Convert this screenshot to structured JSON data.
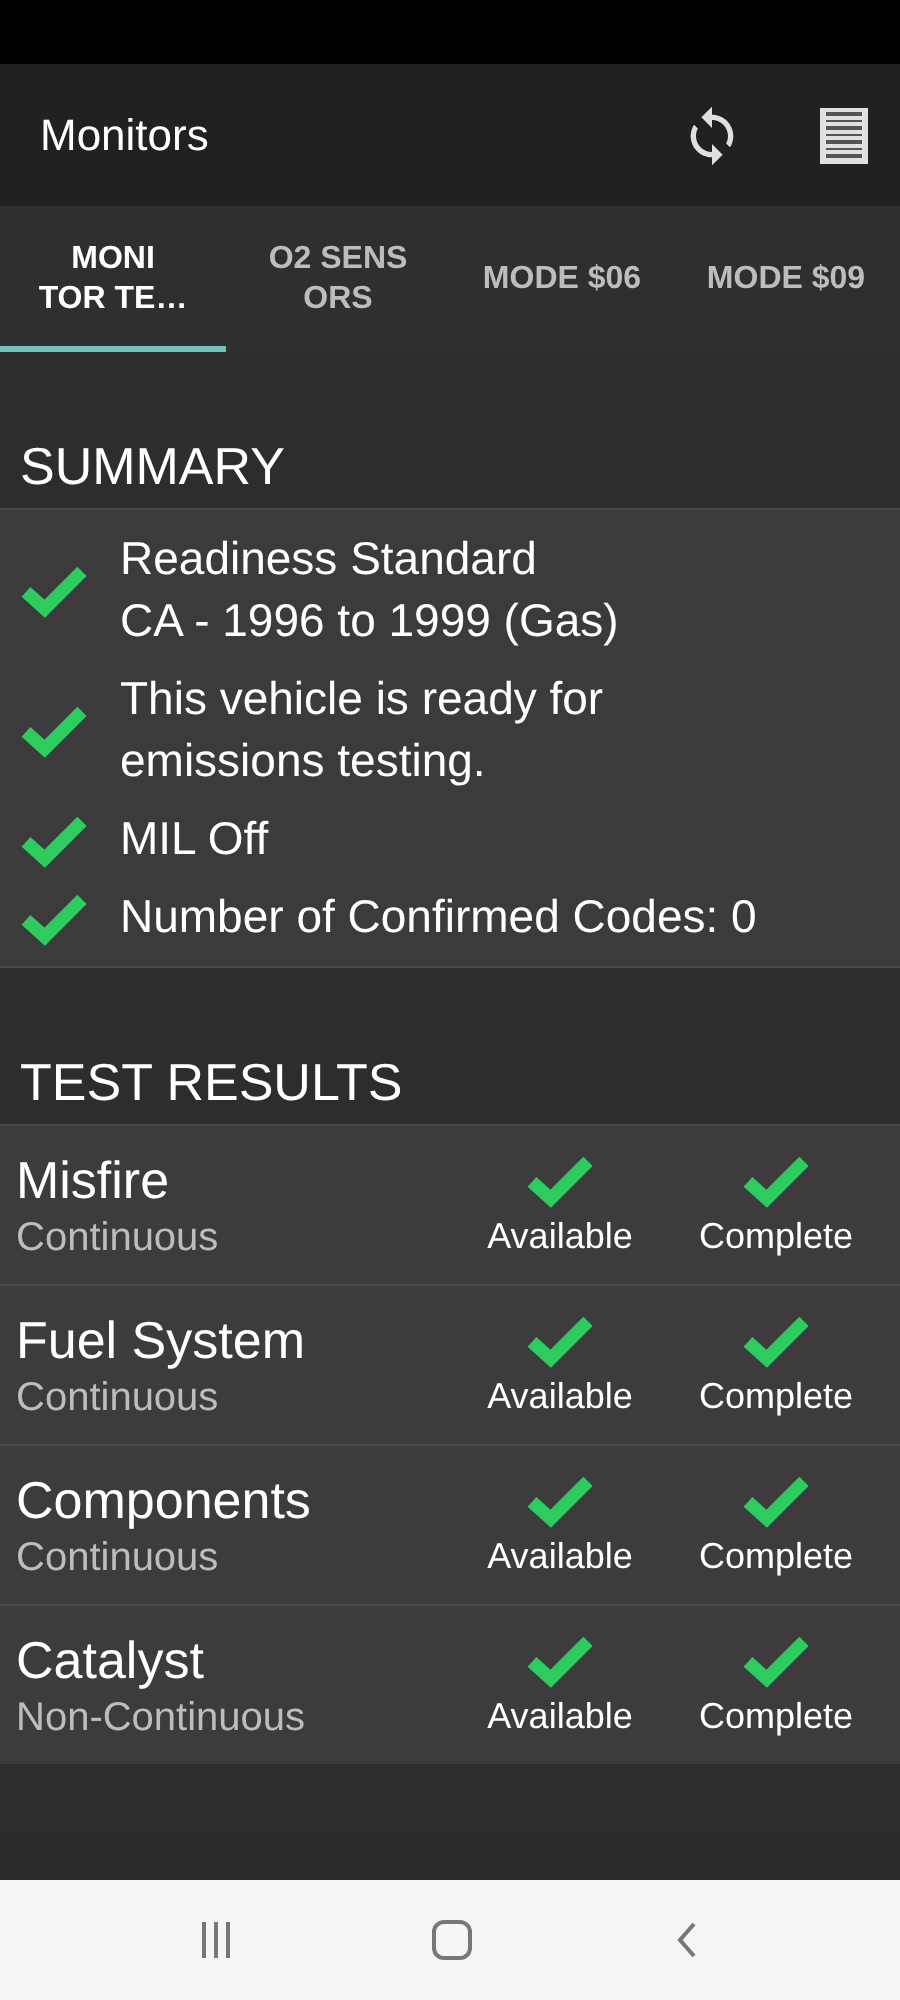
{
  "app_bar": {
    "title": "Monitors"
  },
  "tabs": [
    {
      "label": "MONI\nTOR TE…",
      "selected": true
    },
    {
      "label": "O2 SENS\nORS",
      "selected": false
    },
    {
      "label": "MODE $06",
      "selected": false
    },
    {
      "label": "MODE $09",
      "selected": false
    }
  ],
  "summary": {
    "heading": "SUMMARY",
    "items": [
      {
        "text": "Readiness Standard\nCA - 1996 to 1999 (Gas)",
        "ok": true
      },
      {
        "text": "This vehicle is ready for emissions testing.",
        "ok": true
      },
      {
        "text": "MIL Off",
        "ok": true
      },
      {
        "text": "Number of Confirmed Codes: 0",
        "ok": true
      }
    ]
  },
  "test_results": {
    "heading": "TEST RESULTS",
    "rows": [
      {
        "name": "Misfire",
        "type": "Continuous",
        "available": true,
        "available_label": "Available",
        "complete": true,
        "complete_label": "Complete"
      },
      {
        "name": "Fuel System",
        "type": "Continuous",
        "available": true,
        "available_label": "Available",
        "complete": true,
        "complete_label": "Complete"
      },
      {
        "name": "Components",
        "type": "Continuous",
        "available": true,
        "available_label": "Available",
        "complete": true,
        "complete_label": "Complete"
      },
      {
        "name": "Catalyst",
        "type": "Non-Continuous",
        "available": true,
        "available_label": "Available",
        "complete": true,
        "complete_label": "Complete"
      }
    ]
  }
}
